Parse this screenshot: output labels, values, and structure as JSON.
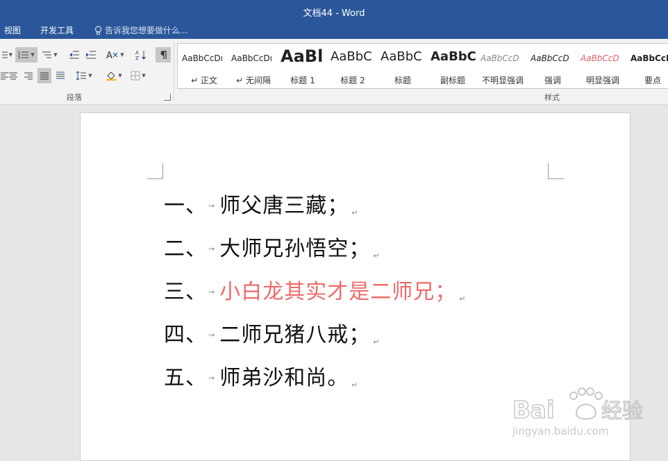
{
  "window": {
    "title": "文档44 - Word"
  },
  "tabs": [
    {
      "label": "视图"
    },
    {
      "label": "开发工具"
    }
  ],
  "tell_me": {
    "text": "告诉我您想要做什么..."
  },
  "ribbon": {
    "paragraph_group_label": "段落",
    "styles_group_label": "样式",
    "styles": [
      {
        "sample": "AaBbCcDı",
        "name": "↵ 正文"
      },
      {
        "sample": "AaBbCcDı",
        "name": "↵ 无间隔"
      },
      {
        "sample": "AaBl",
        "name": "标题 1"
      },
      {
        "sample": "AaBbC",
        "name": "标题 2"
      },
      {
        "sample": "AaBbC",
        "name": "标题"
      },
      {
        "sample": "AaBbC",
        "name": "副标题"
      },
      {
        "sample": "AaBbCcD",
        "name": "不明显强调"
      },
      {
        "sample": "AaBbCcD",
        "name": "强调"
      },
      {
        "sample": "AaBbCcD",
        "name": "明显强调"
      },
      {
        "sample": "AaBbCcDı",
        "name": "要点"
      }
    ]
  },
  "document": {
    "lines": [
      {
        "num": "一、",
        "text": "师父唐三藏；"
      },
      {
        "num": "二、",
        "text": "大师兄孙悟空；"
      },
      {
        "num": "三、",
        "text": "小白龙其实才是二师兄；"
      },
      {
        "num": "四、",
        "text": "二师兄猪八戒；"
      },
      {
        "num": "五、",
        "text": "师弟沙和尚。"
      }
    ],
    "highlight_color": "#f06a6a",
    "tab_mark": "→",
    "para_mark": "↵"
  },
  "watermark": {
    "brand": "Baidu",
    "brand_cn": "经验",
    "url": "jingyan.baidu.com"
  }
}
